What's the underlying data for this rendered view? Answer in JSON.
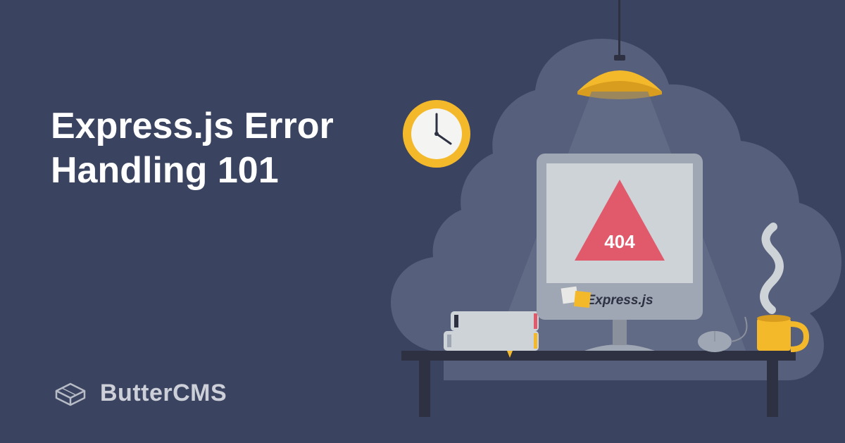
{
  "title": "Express.js Error Handling 101",
  "brand": "ButterCMS",
  "monitor": {
    "error_code": "404",
    "framework_label": "Express.js"
  },
  "colors": {
    "background": "#3a4460",
    "cloud": "#565f7b",
    "yellow": "#f4b92b",
    "red": "#e05a6b",
    "light_gray": "#ced3d8",
    "gray": "#a0a7b4",
    "dark": "#2d3142",
    "white": "#ffffff"
  }
}
